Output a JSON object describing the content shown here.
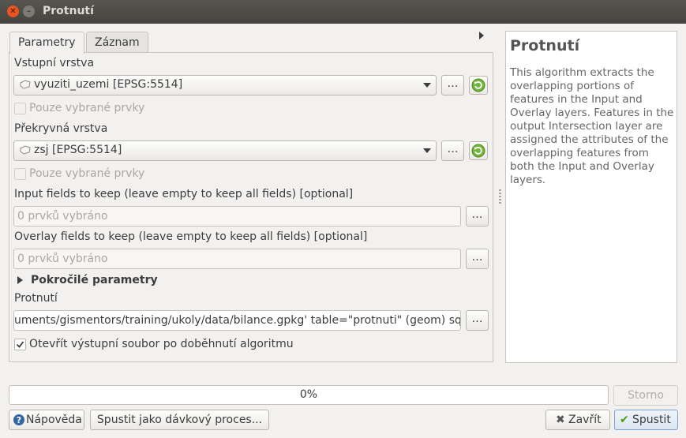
{
  "window": {
    "title": "Protnutí"
  },
  "tabs": [
    {
      "label": "Parametry",
      "active": true
    },
    {
      "label": "Záznam",
      "active": false
    }
  ],
  "params": {
    "input_layer": {
      "label": "Vstupní vrstva",
      "value": "vyuziti_uzemi [EPSG:5514]",
      "selected_only": "Pouze vybrané prvky"
    },
    "overlay_layer": {
      "label": "Překryvná vrstva",
      "value": "zsj [EPSG:5514]",
      "selected_only": "Pouze vybrané prvky"
    },
    "input_fields": {
      "label": "Input fields to keep (leave empty to keep all fields) [optional]",
      "placeholder": "0 prvků vybráno"
    },
    "overlay_fields": {
      "label": "Overlay fields to keep (leave empty to keep all fields) [optional]",
      "placeholder": "0 prvků vybráno"
    },
    "advanced": {
      "label": "Pokročilé parametry"
    },
    "output": {
      "label": "Protnutí",
      "value": "uments/gismentors/training/ukoly/data/bilance.gpkg' table=\"protnuti\" (geom) sql="
    },
    "open_output": {
      "label": "Otevřít výstupní soubor po doběhnutí algoritmu",
      "checked": true
    },
    "browse_label": "…"
  },
  "help": {
    "title": "Protnutí",
    "text": "This algorithm extracts the overlapping portions of features in the Input and Overlay layers. Features in the output Intersection layer are assigned the attributes of the overlapping features from both the Input and Overlay layers."
  },
  "progress": {
    "text": "0%",
    "value": 0
  },
  "buttons": {
    "cancel": "Storno",
    "help": "Nápověda",
    "batch": "Spustit jako dávkový proces...",
    "close": "Zavřít",
    "run": "Spustit"
  },
  "colors": {
    "titlebar": "#4b4944",
    "close_button": "#e95420",
    "accent_green": "#4e9a06"
  }
}
